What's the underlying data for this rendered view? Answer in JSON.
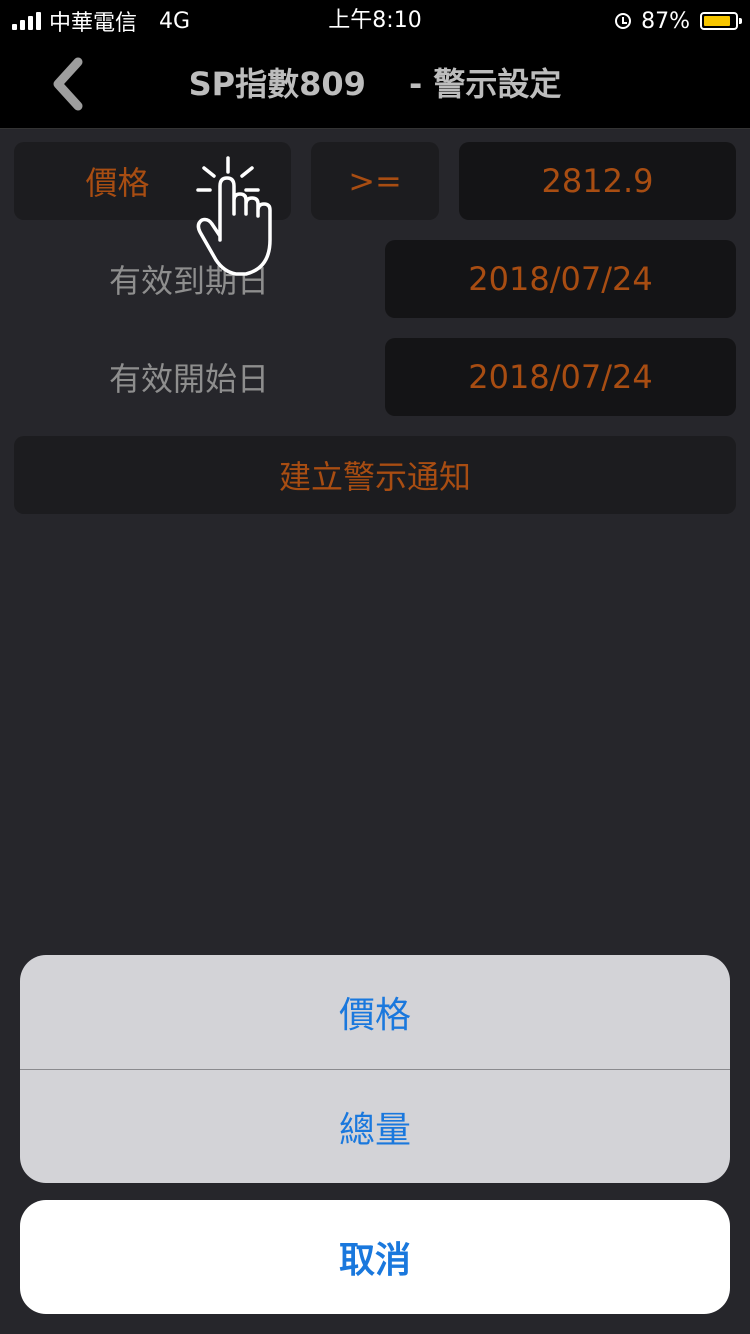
{
  "status_bar": {
    "carrier": "中華電信",
    "network": "4G",
    "time": "上午8:10",
    "battery": "87%",
    "battery_level": 0.87,
    "battery_color": "#f7c600"
  },
  "nav": {
    "title": "SP指數809　 - 警示設定",
    "back_icon": "chevron-left-icon"
  },
  "form": {
    "field_type": "價格",
    "operator": ">=",
    "price_value": "2812.9",
    "expiry_label": "有效到期日",
    "expiry_date": "2018/07/24",
    "start_label": "有效開始日",
    "start_date": "2018/07/24",
    "create_button": "建立警示通知",
    "accent_color": "#a84d12"
  },
  "action_sheet": {
    "options": [
      "價格",
      "總量"
    ],
    "cancel": "取消",
    "option_color": "#1a78dd"
  },
  "overlay": {
    "tap_indicator_icon": "tap-hand-icon"
  }
}
